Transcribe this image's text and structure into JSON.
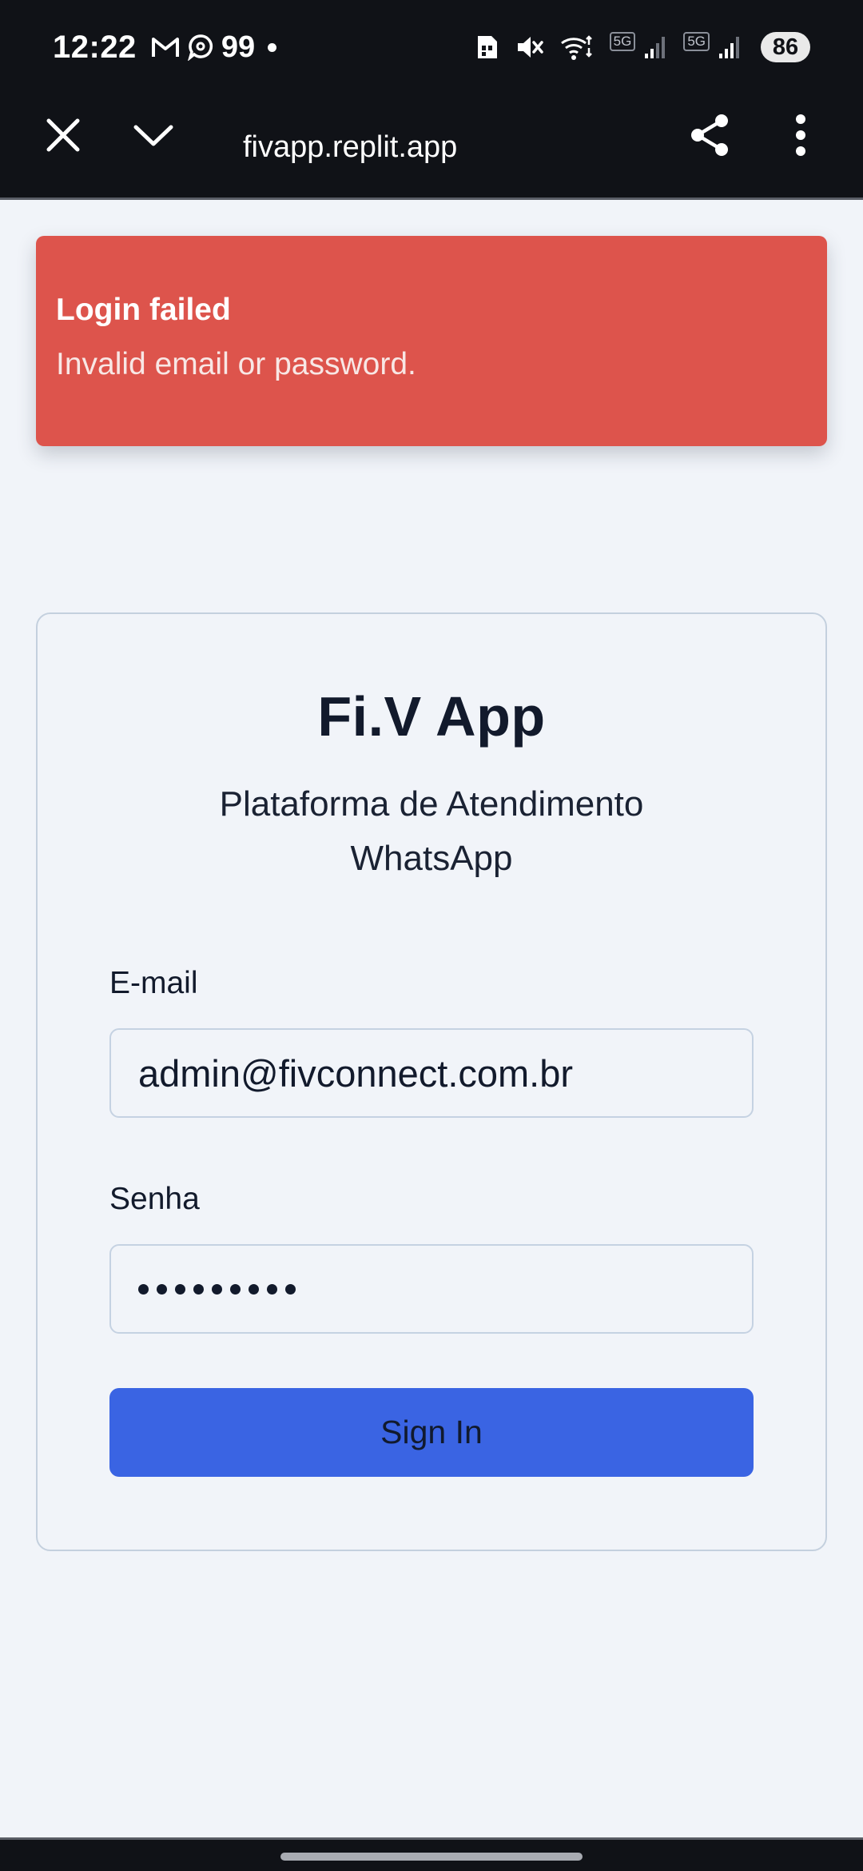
{
  "status_bar": {
    "time": "12:22",
    "notification_count": "99",
    "network_tag_1": "5G",
    "network_tag_2": "5G",
    "battery": "86"
  },
  "browser": {
    "url": "fivapp.replit.app",
    "icons": [
      "close-icon",
      "chevron-down-icon",
      "share-icon",
      "more-vert-icon"
    ]
  },
  "toast": {
    "title": "Login failed",
    "message": "Invalid email or password.",
    "color": "#dd544c"
  },
  "login": {
    "title": "Fi.V App",
    "subtitle_line1": "Plataforma de Atendimento",
    "subtitle_line2": "WhatsApp",
    "email_label": "E-mail",
    "email_value": "admin@fivconnect.com.br",
    "password_label": "Senha",
    "password_mask": "•••••••••",
    "signin_label": "Sign In",
    "accent": "#3a64e3"
  }
}
